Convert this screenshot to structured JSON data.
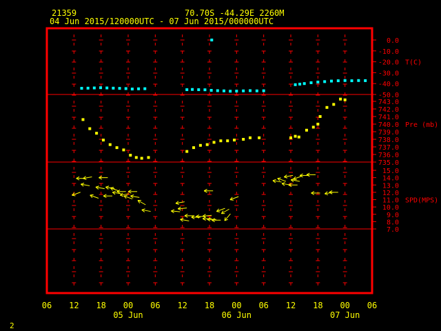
{
  "header": {
    "station": "21359",
    "location": "70.70S  -44.29E  2260M",
    "time_range": "04 Jun 2015/120000UTC - 07 Jun 2015/000000UTC"
  },
  "footer": {
    "page_number": "2"
  },
  "colors": {
    "background": "#000000",
    "frame": "#ff0000",
    "header_text": "#ffff00",
    "axis_text": "#ffff00",
    "panel_labels": "#ff0000",
    "temperature": "#00ffff",
    "pressure": "#ffff00",
    "wind": "#ffff00"
  },
  "chart_data": {
    "type": "scatter",
    "x_axis": {
      "unit": "hours since 04 Jun 2015 06 UTC",
      "range": [
        0,
        72
      ],
      "tick_labels": [
        "06",
        "12",
        "18",
        "00",
        "06",
        "12",
        "18",
        "00",
        "06",
        "12",
        "18",
        "00",
        "06"
      ],
      "date_labels": [
        {
          "text": "05 Jun",
          "at": 18
        },
        {
          "text": "06 Jun",
          "at": 42
        },
        {
          "text": "07 Jun",
          "at": 66
        }
      ]
    },
    "panels": [
      {
        "name": "temperature",
        "label": "T(C)",
        "range": [
          -50,
          0
        ],
        "tick_labels": [
          "0.0",
          "-10.0",
          "-20.0",
          "-30.0",
          "-40.0",
          "-50.0"
        ],
        "ticks": [
          0,
          -10,
          -20,
          -30,
          -40,
          -50
        ],
        "label_at": -20,
        "marker": "square",
        "points": [
          [
            7.7,
            -44.3
          ],
          [
            9.1,
            -44.2
          ],
          [
            10.5,
            -44.0
          ],
          [
            11.9,
            -43.8
          ],
          [
            13.3,
            -44.0
          ],
          [
            14.7,
            -44.2
          ],
          [
            16.1,
            -44.4
          ],
          [
            17.5,
            -44.6
          ],
          [
            18.9,
            -45.0
          ],
          [
            20.3,
            -44.8
          ],
          [
            21.7,
            -44.7
          ],
          [
            32.2,
            -45.4
          ],
          [
            33.6,
            -45.6
          ],
          [
            35.0,
            -45.7
          ],
          [
            36.4,
            -46.2
          ],
          [
            37.8,
            -46.5
          ],
          [
            39.2,
            -46.7
          ],
          [
            40.6,
            -47.0
          ],
          [
            42.0,
            -46.9
          ],
          [
            43.5,
            -46.7
          ],
          [
            45.0,
            -46.5
          ],
          [
            46.5,
            -46.7
          ],
          [
            48.0,
            -46.6
          ],
          [
            31.0,
            -45.6
          ],
          [
            55.0,
            -41.0
          ],
          [
            56.0,
            -40.5
          ],
          [
            57.0,
            -40.0
          ],
          [
            58.5,
            -39.2
          ],
          [
            60.0,
            -38.6
          ],
          [
            61.5,
            -38.2
          ],
          [
            63.0,
            -37.7
          ],
          [
            64.5,
            -37.4
          ],
          [
            66.0,
            -37.2
          ],
          [
            67.5,
            -37.4
          ],
          [
            69.0,
            -37.2
          ],
          [
            70.5,
            -37.3
          ],
          [
            36.5,
            0
          ]
        ]
      },
      {
        "name": "pressure",
        "label": "Pre (mb)",
        "range": [
          735,
          743
        ],
        "tick_labels": [
          "735.0",
          "736.0",
          "737.0",
          "738.0",
          "739.0",
          "740.0",
          "741.0",
          "742.0",
          "743.0"
        ],
        "ticks": [
          735,
          736,
          737,
          738,
          739,
          740,
          741,
          742,
          743
        ],
        "label_at": 740,
        "marker": "square",
        "points": [
          [
            8.0,
            740.6
          ],
          [
            9.5,
            739.4
          ],
          [
            11.0,
            738.8
          ],
          [
            12.5,
            737.9
          ],
          [
            14.0,
            737.3
          ],
          [
            15.5,
            736.9
          ],
          [
            17.0,
            736.6
          ],
          [
            18.5,
            735.9
          ],
          [
            19.8,
            735.6
          ],
          [
            21.0,
            735.5
          ],
          [
            22.5,
            735.6
          ],
          [
            31.0,
            736.4
          ],
          [
            32.5,
            736.9
          ],
          [
            34.0,
            737.2
          ],
          [
            35.5,
            737.3
          ],
          [
            37.0,
            737.6
          ],
          [
            38.5,
            737.8
          ],
          [
            40.0,
            737.8
          ],
          [
            41.5,
            737.9
          ],
          [
            43.5,
            738.0
          ],
          [
            45.0,
            738.2
          ],
          [
            47.0,
            738.2
          ],
          [
            54.0,
            738.2
          ],
          [
            55.0,
            738.4
          ],
          [
            55.8,
            738.3
          ],
          [
            57.5,
            739.2
          ],
          [
            59.0,
            739.6
          ],
          [
            60.0,
            740.0
          ],
          [
            60.5,
            741.0
          ],
          [
            62.0,
            742.2
          ],
          [
            63.5,
            742.6
          ],
          [
            65.0,
            743.3
          ],
          [
            66.0,
            743.2
          ]
        ]
      },
      {
        "name": "wind",
        "label": "SPD(MPS)",
        "range": [
          7,
          15
        ],
        "tick_labels": [
          "7.0",
          "8.0",
          "9.0",
          "10.0",
          "11.0",
          "12.0",
          "13.0",
          "14.0",
          "15.0"
        ],
        "ticks": [
          7,
          8,
          9,
          10,
          11,
          12,
          13,
          14,
          15
        ],
        "label_at": 11,
        "marker": "arrow",
        "points": [
          {
            "x": 6.5,
            "y": 11.8,
            "dir": 200
          },
          {
            "x": 7.5,
            "y": 13.9,
            "dir": 180
          },
          {
            "x": 8.5,
            "y": 13.0,
            "dir": 170
          },
          {
            "x": 9.0,
            "y": 14.0,
            "dir": 190
          },
          {
            "x": 10.5,
            "y": 11.4,
            "dir": 160
          },
          {
            "x": 11.8,
            "y": 12.6,
            "dir": 170
          },
          {
            "x": 12.5,
            "y": 14.0,
            "dir": 180
          },
          {
            "x": 13.5,
            "y": 11.5,
            "dir": 180
          },
          {
            "x": 14.0,
            "y": 12.6,
            "dir": 170
          },
          {
            "x": 15.0,
            "y": 12.4,
            "dir": 160
          },
          {
            "x": 15.5,
            "y": 11.9,
            "dir": 170
          },
          {
            "x": 16.5,
            "y": 12.1,
            "dir": 180
          },
          {
            "x": 17.2,
            "y": 11.7,
            "dir": 190
          },
          {
            "x": 18.0,
            "y": 11.3,
            "dir": 160
          },
          {
            "x": 19.0,
            "y": 12.1,
            "dir": 180
          },
          {
            "x": 19.5,
            "y": 11.4,
            "dir": 170
          },
          {
            "x": 21.0,
            "y": 10.6,
            "dir": 150
          },
          {
            "x": 22.0,
            "y": 9.5,
            "dir": 170
          },
          {
            "x": 28.5,
            "y": 9.4,
            "dir": 175
          },
          {
            "x": 29.5,
            "y": 10.6,
            "dir": 190
          },
          {
            "x": 30.0,
            "y": 9.8,
            "dir": 185
          },
          {
            "x": 30.5,
            "y": 8.2,
            "dir": 170
          },
          {
            "x": 31.5,
            "y": 8.8,
            "dir": 180
          },
          {
            "x": 33.0,
            "y": 8.6,
            "dir": 180
          },
          {
            "x": 34.0,
            "y": 8.7,
            "dir": 180
          },
          {
            "x": 35.5,
            "y": 8.4,
            "dir": 180
          },
          {
            "x": 36.5,
            "y": 8.3,
            "dir": 180
          },
          {
            "x": 37.5,
            "y": 8.2,
            "dir": 180
          },
          {
            "x": 35.8,
            "y": 12.2,
            "dir": 180
          },
          {
            "x": 35.5,
            "y": 8.8,
            "dir": 185
          },
          {
            "x": 38.5,
            "y": 9.6,
            "dir": 200
          },
          {
            "x": 39.5,
            "y": 9.4,
            "dir": 210
          },
          {
            "x": 40.0,
            "y": 8.6,
            "dir": 230
          },
          {
            "x": 41.5,
            "y": 11.2,
            "dir": 200
          },
          {
            "x": 51.0,
            "y": 13.5,
            "dir": 170
          },
          {
            "x": 52.0,
            "y": 13.7,
            "dir": 160
          },
          {
            "x": 53.0,
            "y": 13.1,
            "dir": 170
          },
          {
            "x": 53.5,
            "y": 14.2,
            "dir": 190
          },
          {
            "x": 54.5,
            "y": 13.0,
            "dir": 180
          },
          {
            "x": 55.0,
            "y": 13.6,
            "dir": 170
          },
          {
            "x": 55.5,
            "y": 14.0,
            "dir": 200
          },
          {
            "x": 57.0,
            "y": 14.3,
            "dir": 180
          },
          {
            "x": 58.5,
            "y": 14.4,
            "dir": 180
          },
          {
            "x": 59.5,
            "y": 11.9,
            "dir": 180
          },
          {
            "x": 62.5,
            "y": 11.9,
            "dir": 190
          },
          {
            "x": 63.5,
            "y": 12.0,
            "dir": 180
          }
        ]
      }
    ],
    "grid": "dashed vertical lines every 6 hours",
    "legend": "none"
  }
}
